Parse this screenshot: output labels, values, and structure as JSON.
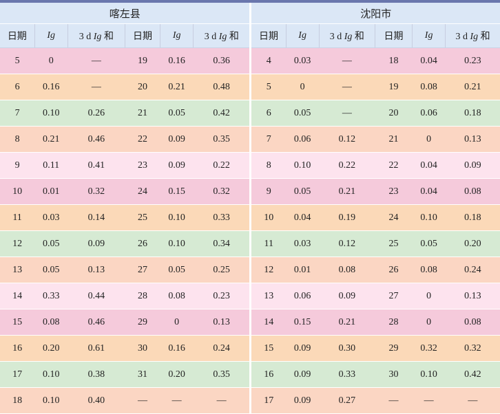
{
  "regions": [
    "喀左县",
    "沈阳市"
  ],
  "headers": [
    "日期",
    "Ig",
    "3 d Ig 和",
    "日期",
    "Ig",
    "3 d Ig 和",
    "日期",
    "Ig",
    "3 d Ig 和",
    "日期",
    "Ig",
    "3 d Ig 和"
  ],
  "header_parts": {
    "date": "日期",
    "ig": "Ig",
    "sum_prefix": "3 d ",
    "sum_ig": "Ig",
    "sum_suffix": " 和"
  },
  "row_colors": [
    "#f5cadb",
    "#fbd9b8",
    "#d6ead3",
    "#fbd6c3",
    "#fde3ee"
  ],
  "rows": [
    [
      "5",
      "0",
      "—",
      "19",
      "0.16",
      "0.36",
      "4",
      "0.03",
      "—",
      "18",
      "0.04",
      "0.23"
    ],
    [
      "6",
      "0.16",
      "—",
      "20",
      "0.21",
      "0.48",
      "5",
      "0",
      "—",
      "19",
      "0.08",
      "0.21"
    ],
    [
      "7",
      "0.10",
      "0.26",
      "21",
      "0.05",
      "0.42",
      "6",
      "0.05",
      "—",
      "20",
      "0.06",
      "0.18"
    ],
    [
      "8",
      "0.21",
      "0.46",
      "22",
      "0.09",
      "0.35",
      "7",
      "0.06",
      "0.12",
      "21",
      "0",
      "0.13"
    ],
    [
      "9",
      "0.11",
      "0.41",
      "23",
      "0.09",
      "0.22",
      "8",
      "0.10",
      "0.22",
      "22",
      "0.04",
      "0.09"
    ],
    [
      "10",
      "0.01",
      "0.32",
      "24",
      "0.15",
      "0.32",
      "9",
      "0.05",
      "0.21",
      "23",
      "0.04",
      "0.08"
    ],
    [
      "11",
      "0.03",
      "0.14",
      "25",
      "0.10",
      "0.33",
      "10",
      "0.04",
      "0.19",
      "24",
      "0.10",
      "0.18"
    ],
    [
      "12",
      "0.05",
      "0.09",
      "26",
      "0.10",
      "0.34",
      "11",
      "0.03",
      "0.12",
      "25",
      "0.05",
      "0.20"
    ],
    [
      "13",
      "0.05",
      "0.13",
      "27",
      "0.05",
      "0.25",
      "12",
      "0.01",
      "0.08",
      "26",
      "0.08",
      "0.24"
    ],
    [
      "14",
      "0.33",
      "0.44",
      "28",
      "0.08",
      "0.23",
      "13",
      "0.06",
      "0.09",
      "27",
      "0",
      "0.13"
    ],
    [
      "15",
      "0.08",
      "0.46",
      "29",
      "0",
      "0.13",
      "14",
      "0.15",
      "0.21",
      "28",
      "0",
      "0.08"
    ],
    [
      "16",
      "0.20",
      "0.61",
      "30",
      "0.16",
      "0.24",
      "15",
      "0.09",
      "0.30",
      "29",
      "0.32",
      "0.32"
    ],
    [
      "17",
      "0.10",
      "0.38",
      "31",
      "0.20",
      "0.35",
      "16",
      "0.09",
      "0.33",
      "30",
      "0.10",
      "0.42"
    ],
    [
      "18",
      "0.10",
      "0.40",
      "—",
      "—",
      "—",
      "17",
      "0.09",
      "0.27",
      "—",
      "—",
      "—"
    ]
  ]
}
